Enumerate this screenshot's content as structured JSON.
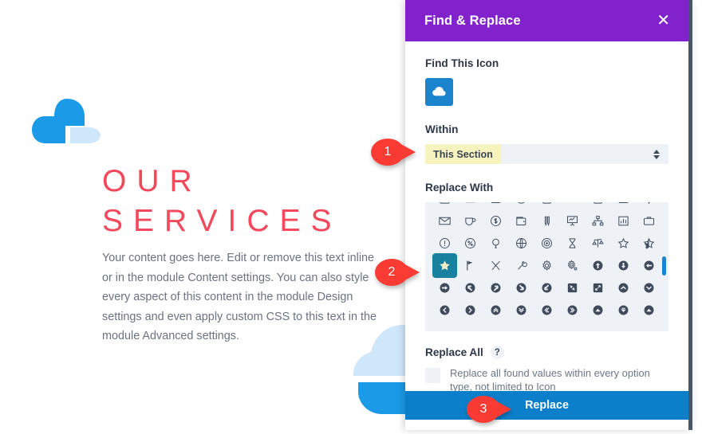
{
  "page": {
    "logo_icon": "cloud-logo",
    "heading": "OUR\nSERVICES",
    "body": "Your content goes here. Edit or remove this text inline or in the module Content settings. You can also style every aspect of this content in the module Design settings and even apply custom CSS to this text in the module Advanced settings.",
    "heading_color": "#f2495c",
    "logo_color": "#1b9ae8",
    "deco_icon": "cloud-decoration"
  },
  "modal": {
    "title": "Find & Replace",
    "close_icon": "close-icon",
    "header_color": "#8222cd",
    "find_label": "Find This Icon",
    "find_icon": "cloud-icon",
    "find_icon_bg": "#1b84cd",
    "within_label": "Within",
    "within_value": "This Section",
    "within_highlight": "#f7f3bf",
    "replace_with_label": "Replace With",
    "selected_icon": "star-icon",
    "selected_icon_bg": "#1881a0",
    "scrollbar_color": "#1b84cd",
    "replace_all_label": "Replace All",
    "help_badge": "?",
    "checkbox_checked": false,
    "checkbox_text": "Replace all found values within every option type, not limited to Icon",
    "replace_button_label": "Replace",
    "replace_button_color": "#0c7fca"
  },
  "icon_grid": {
    "columns": 9,
    "rows": [
      [
        "book-icon",
        "card-icon",
        "tag-icon",
        "circle-icon",
        "note-icon",
        "tray-icon",
        "bag-icon",
        "box-icon",
        "pin-icon"
      ],
      [
        "envelope-icon",
        "cup-icon",
        "dollar-circle-icon",
        "wallet-icon",
        "pens-icon",
        "presentation-chart-icon",
        "sitemap-icon",
        "bar-chart-icon",
        "briefcase-icon"
      ],
      [
        "exclamation-circle-icon",
        "percent-circle-icon",
        "balloon-icon",
        "globe-icon",
        "target-icon",
        "hourglass-icon",
        "scales-icon",
        "star-outline-icon",
        "star-half-icon"
      ],
      [
        "star-icon",
        "flag-icon",
        "tools-icon",
        "wrench-icon",
        "gear-icon",
        "gear-small-icon",
        "arrow-up-circle-icon",
        "arrow-down-circle-icon",
        "arrow-left-circle-icon"
      ],
      [
        "arrow-right-circle-icon",
        "arrow-upleft-circle-icon",
        "arrow-upright-circle-icon",
        "arrow-downright-circle-icon",
        "arrow-downleft-circle-icon",
        "compress-icon",
        "expand-icon",
        "chevron-up-circle-icon",
        "chevron-down-circle-icon"
      ],
      [
        "chevron-left-circle-icon",
        "chevron-right-circle-icon",
        "chevrons-up-circle-icon",
        "chevrons-down-circle-icon",
        "chevrons-left-circle-icon",
        "chevrons-right-circle-icon",
        "caret-up-icon",
        "caret-down-icon",
        "caret-up-alt-icon"
      ]
    ],
    "selected_row": 3,
    "selected_col": 0
  },
  "markers": [
    {
      "number": "1",
      "target": "within-select"
    },
    {
      "number": "2",
      "target": "selected-star-icon"
    },
    {
      "number": "3",
      "target": "replace-button"
    }
  ]
}
